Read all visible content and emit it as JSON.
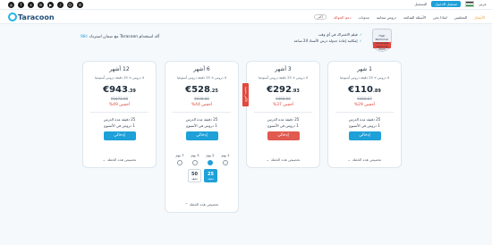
{
  "topbar": {
    "flag_label": "العربية",
    "language_label": "عربي",
    "login_label": "تسجيل الدخول",
    "signup_label": "التسجيل",
    "social_icons": [
      "instagram-icon",
      "facebook-icon",
      "x-icon",
      "linkedin-icon",
      "youtube-icon",
      "tiktok-icon",
      "snapchat-icon",
      "whatsapp-icon"
    ]
  },
  "nav": {
    "logo": "Taracoon",
    "items": [
      "الأسعار",
      "المعلمين",
      "لماذا نحن",
      "الأسئلة الشائعة",
      "دروس مجانية",
      "مدونات",
      "دعم الحوالة"
    ],
    "more_label": "أكثر",
    "accent": "#f29a2e",
    "brand": "#1ea0d8"
  },
  "hero": {
    "guarantee_prefix": "أكد استخدام Taracoon مع ضمان استرداد",
    "guarantee_highlight": "٪98",
    "features": [
      "فيلم الاشتراك في أي وقت",
      "إمكانية إعادة جدولة درس الأستاذ 24 ساعة"
    ],
    "badge_title": "High Performer",
    "badge_sub": "Language Learning",
    "badge_year": "2023"
  },
  "plans": [
    {
      "duration": "1 شهر",
      "lessons": "4 دروس × 25 دقيقة دروس أسبوعيا",
      "price_int": "€110",
      "price_dec": ".89",
      "old_price": "€156.67",
      "discount": "أخفض 29%",
      "perks": [
        "25 دقيقة مدة الدرس",
        "1 دروس في الأسبوع"
      ],
      "cta": "إدخالي",
      "customize": "تخصيص هذه الخطة"
    },
    {
      "duration": "3 أشهر",
      "lessons": "4 دروس × 25 دقيقة دروس أسبوعيا",
      "price_int": "€292",
      "price_dec": ".93",
      "old_price": "€468.00",
      "discount": "أخفض 37%",
      "perks": [
        "25 دقيقة مدة الدرس",
        "1 دروس في الأسبوع"
      ],
      "cta": "إدخالي",
      "customize": "تخصيص هذه الخطة",
      "ribbon": "الأكثر شعبية"
    },
    {
      "duration": "6 أشهر",
      "lessons": "4 دروس × 25 دقيقة دروس أسبوعيا",
      "price_int": "€528",
      "price_dec": ".25",
      "old_price": "€936.00",
      "discount": "أخفض 44%",
      "perks": [
        "25 دقيقة مدة الدرس",
        "1 دروس في الأسبوع"
      ],
      "cta": "إدخالي",
      "customize": "تخصيص هذه الخطة",
      "day_options": [
        "1 يوم",
        "2 يوم",
        "3 يوم",
        "7 يوم"
      ],
      "selected_day": 1,
      "minute_options": [
        {
          "value": "25",
          "unit": "دقيقة"
        },
        {
          "value": "50",
          "unit": "دقيقة"
        }
      ],
      "selected_minute": 0
    },
    {
      "duration": "12 أشهر",
      "lessons": "4 دروس × 25 دقيقة دروس أسبوعيا",
      "price_int": "€943",
      "price_dec": ".39",
      "old_price": "€1872.00",
      "discount": "أخفض 49%",
      "perks": [
        "25 دقيقة مدة الدرس",
        "1 دروس في الأسبوع"
      ],
      "cta": "إدخالي",
      "customize": "تخصيص هذه الخطة"
    }
  ]
}
